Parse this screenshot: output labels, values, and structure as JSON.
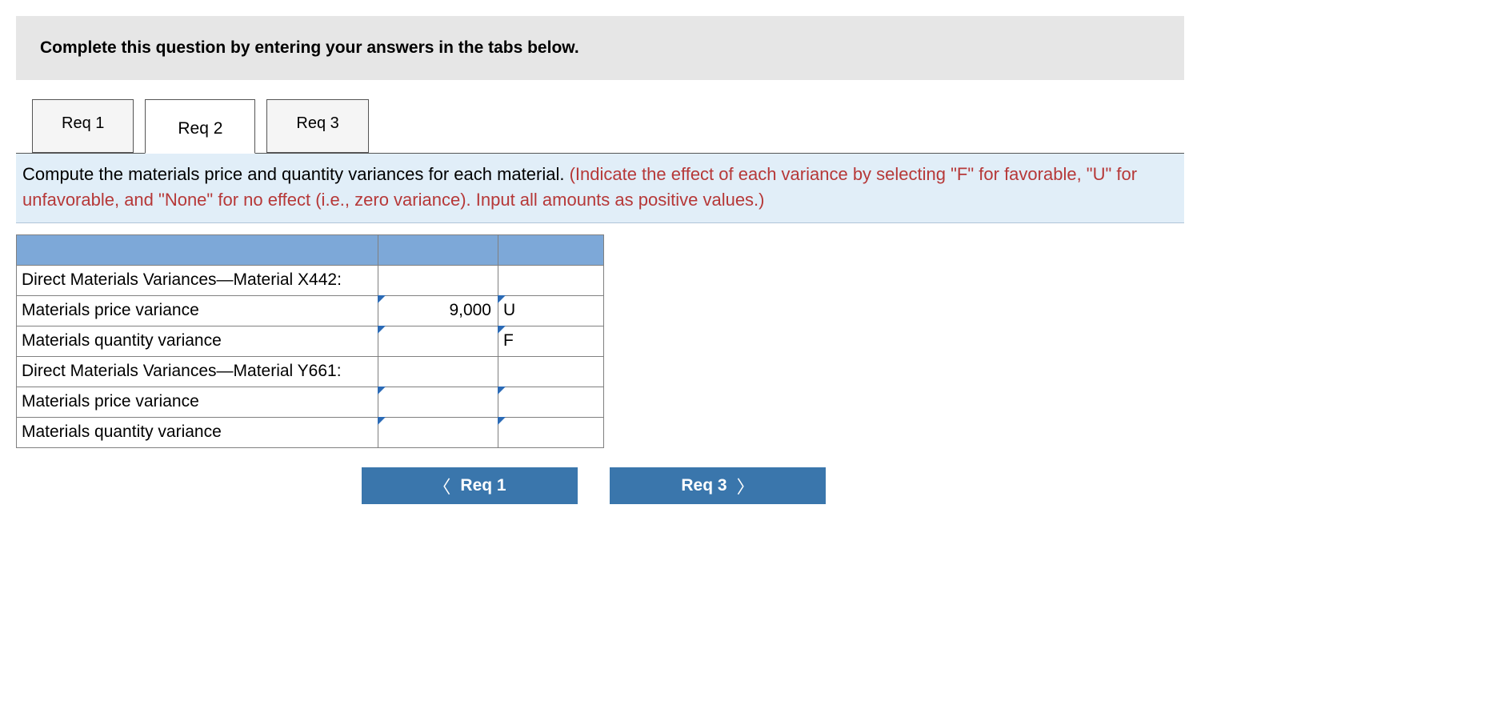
{
  "banner": {
    "text": "Complete this question by entering your answers in the tabs below."
  },
  "tabs": [
    {
      "label": "Req 1",
      "active": false
    },
    {
      "label": "Req 2",
      "active": true
    },
    {
      "label": "Req 3",
      "active": false
    }
  ],
  "prompt": {
    "black": "Compute the materials price and quantity variances for each material. ",
    "red": "(Indicate the effect of each variance by selecting \"F\" for favorable, \"U\" for unfavorable, and \"None\" for no effect (i.e., zero variance). Input all amounts as positive values.)"
  },
  "table": {
    "rows": [
      {
        "label": "Direct Materials Variances—Material X442:",
        "value": "",
        "effect": "",
        "editable": false
      },
      {
        "label": "Materials price variance",
        "value": "9,000",
        "effect": "U",
        "editable": true
      },
      {
        "label": "Materials quantity variance",
        "value": "",
        "effect": "F",
        "editable": true
      },
      {
        "label": "Direct Materials Variances—Material Y661:",
        "value": "",
        "effect": "",
        "editable": false
      },
      {
        "label": "Materials price variance",
        "value": "",
        "effect": "",
        "editable": true
      },
      {
        "label": "Materials quantity variance",
        "value": "",
        "effect": "",
        "editable": true
      }
    ]
  },
  "nav": {
    "prev_label": "Req 1",
    "next_label": "Req 3"
  }
}
